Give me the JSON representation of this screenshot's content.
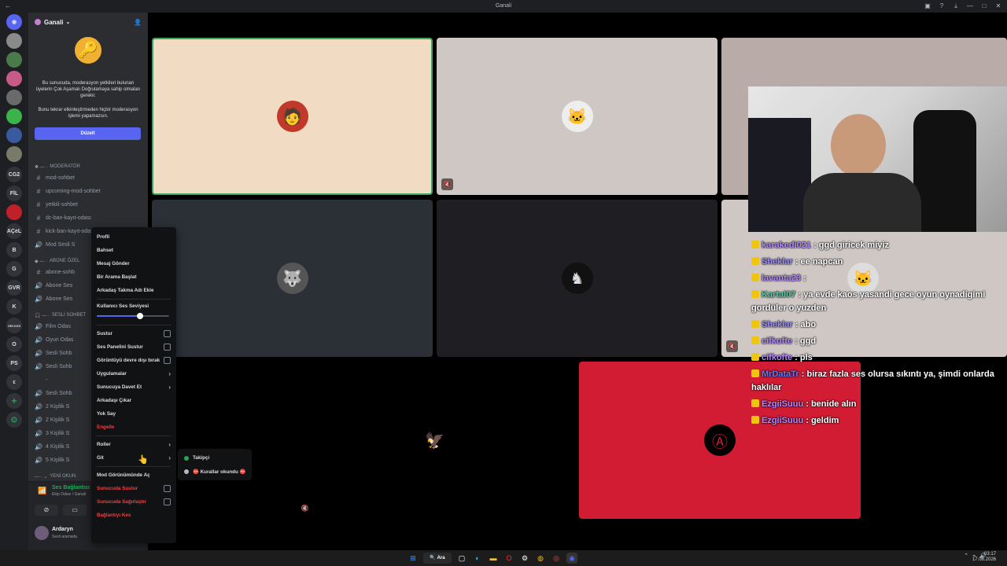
{
  "window": {
    "title": "Ganali"
  },
  "server": {
    "name": "Ganali",
    "notice_text_1": "Bu sunucuda, moderasyon yetkileri bulunan üyelerin Çok Aşamalı Doğrulamaya sahip olmaları gerekir.",
    "notice_text_2": "Bunu tekrar etkinleştirmeden hiçbir moderasyon işlemi yapamazsın.",
    "fix_button": "Düzelt"
  },
  "server_list": [
    "CG2",
    "FİL",
    "AÇeL",
    "B",
    "G",
    "GVR",
    "K",
    "OELKIOI",
    "O",
    "PS",
    "ε"
  ],
  "categories": {
    "moderator": "MODERATÖR",
    "abone": "ABONE ÖZEL",
    "sesli": "SESLİ SOHBET",
    "yeni": "YENİ OKUN"
  },
  "channels_mod": [
    {
      "icon": "#",
      "label": "mod-sohbet"
    },
    {
      "icon": "#",
      "label": "upcoming-mod-sohbet"
    },
    {
      "icon": "#",
      "label": "yetkili-sohbet"
    },
    {
      "icon": "#",
      "label": "dc-ban-kayıt-odası"
    },
    {
      "icon": "#",
      "label": "kick-ban-kayıt-odası"
    },
    {
      "icon": "🔊",
      "label": "Mod Sesli S"
    }
  ],
  "channels_abone": [
    {
      "icon": "#",
      "label": "abone-sohb"
    },
    {
      "icon": "🔊",
      "label": "Abone Ses"
    },
    {
      "icon": "🔊",
      "label": "Abone Ses"
    }
  ],
  "channels_sesli": [
    {
      "icon": "🔊",
      "label": "Film Odas"
    },
    {
      "icon": "🔊",
      "label": "Oyun Odas"
    },
    {
      "icon": "🔊",
      "label": "Sesli Sohb"
    },
    {
      "icon": "🔊",
      "label": "Sesli Sohb"
    },
    {
      "icon": "",
      "label": "-"
    },
    {
      "icon": "🔊",
      "label": "Sesli Sohb"
    },
    {
      "icon": "🔊",
      "label": "2 Kişilik S"
    },
    {
      "icon": "🔊",
      "label": "2 Kişilik S"
    },
    {
      "icon": "🔊",
      "label": "3 Kişilik S"
    },
    {
      "icon": "🔊",
      "label": "4 Kişilik S"
    },
    {
      "icon": "🔊",
      "label": "5 Kişilik S"
    }
  ],
  "voice": {
    "status": "Ses Bağlantısı Kuruldu",
    "channel": "Ekip Odası / Ganali"
  },
  "user": {
    "name": "Ardaryn",
    "status": "Sesli aramada"
  },
  "context_menu": {
    "profile": "Profil",
    "mention": "Bahset",
    "message": "Mesaj Gönder",
    "call": "Bir Arama Başlat",
    "nickname": "Arkadaş Takma Adı Ekle",
    "volume_label": "Kullanıcı Ses Seviyesi",
    "volume_fraction": 0.6,
    "mute": "Sustur",
    "soundboard_mute": "Ses Panelini Sustur",
    "video_off": "Görüntüyü devre dışı bırak",
    "apps": "Uygulamalar",
    "invite": "Sunucuya Davet Et",
    "remove_friend": "Arkadaşı Çıkar",
    "ignore": "Yok Say",
    "block": "Engelle",
    "roles": "Roller",
    "go": "Git",
    "mod_view": "Mod Görünümünde Aç",
    "server_mute": "Sunucuda Sustur",
    "server_deafen": "Sunucuda Sağırlaştır",
    "disconnect": "Bağlantıyı Kes"
  },
  "roles_submenu": [
    {
      "label": "Takipçi",
      "color": "#23a55a"
    },
    {
      "label": "⛔ Kurallar okundu ⛔",
      "color": "#b5bac1"
    }
  ],
  "chat": [
    {
      "user": "karakedi021",
      "text": ": ggd giricek miyiz",
      "color": "#b388ff"
    },
    {
      "user": "Sheklar",
      "text": ": ee napcan",
      "color": "#9b8cff"
    },
    {
      "user": "lavanta23",
      "text": ":",
      "color": "#b388ff"
    },
    {
      "user": "Kartal07",
      "text": ": ya evde kaos yasandi gece oyun oynadigimi gordüler o yuzden",
      "color": "#4fd1a5"
    },
    {
      "user": "Sheklar",
      "text": ": abo",
      "color": "#9b8cff"
    },
    {
      "user": "cifkofte",
      "text": ": ggd",
      "color": "#b388ff"
    },
    {
      "user": "cifkofte",
      "text": ": pls",
      "color": "#b388ff"
    },
    {
      "user": "MrDataTr",
      "text": ": biraz fazla ses olursa sıkıntı ya, şimdi onlarda haklılar",
      "color": "#5b7cff"
    },
    {
      "user": "EzgiiSuuu",
      "text": ": benide alın",
      "color": "#b388ff"
    },
    {
      "user": "EzgiiSuuu",
      "text": ": geldim",
      "color": "#b388ff"
    }
  ],
  "taskbar": {
    "search": "Ara",
    "time": "03:17",
    "date": "17.08.2026"
  },
  "colors": {
    "blurple": "#5865f2",
    "red_tile": "#d21c34",
    "peach_tile": "#f1dcc3",
    "grey_tile": "#cfc7c4"
  }
}
